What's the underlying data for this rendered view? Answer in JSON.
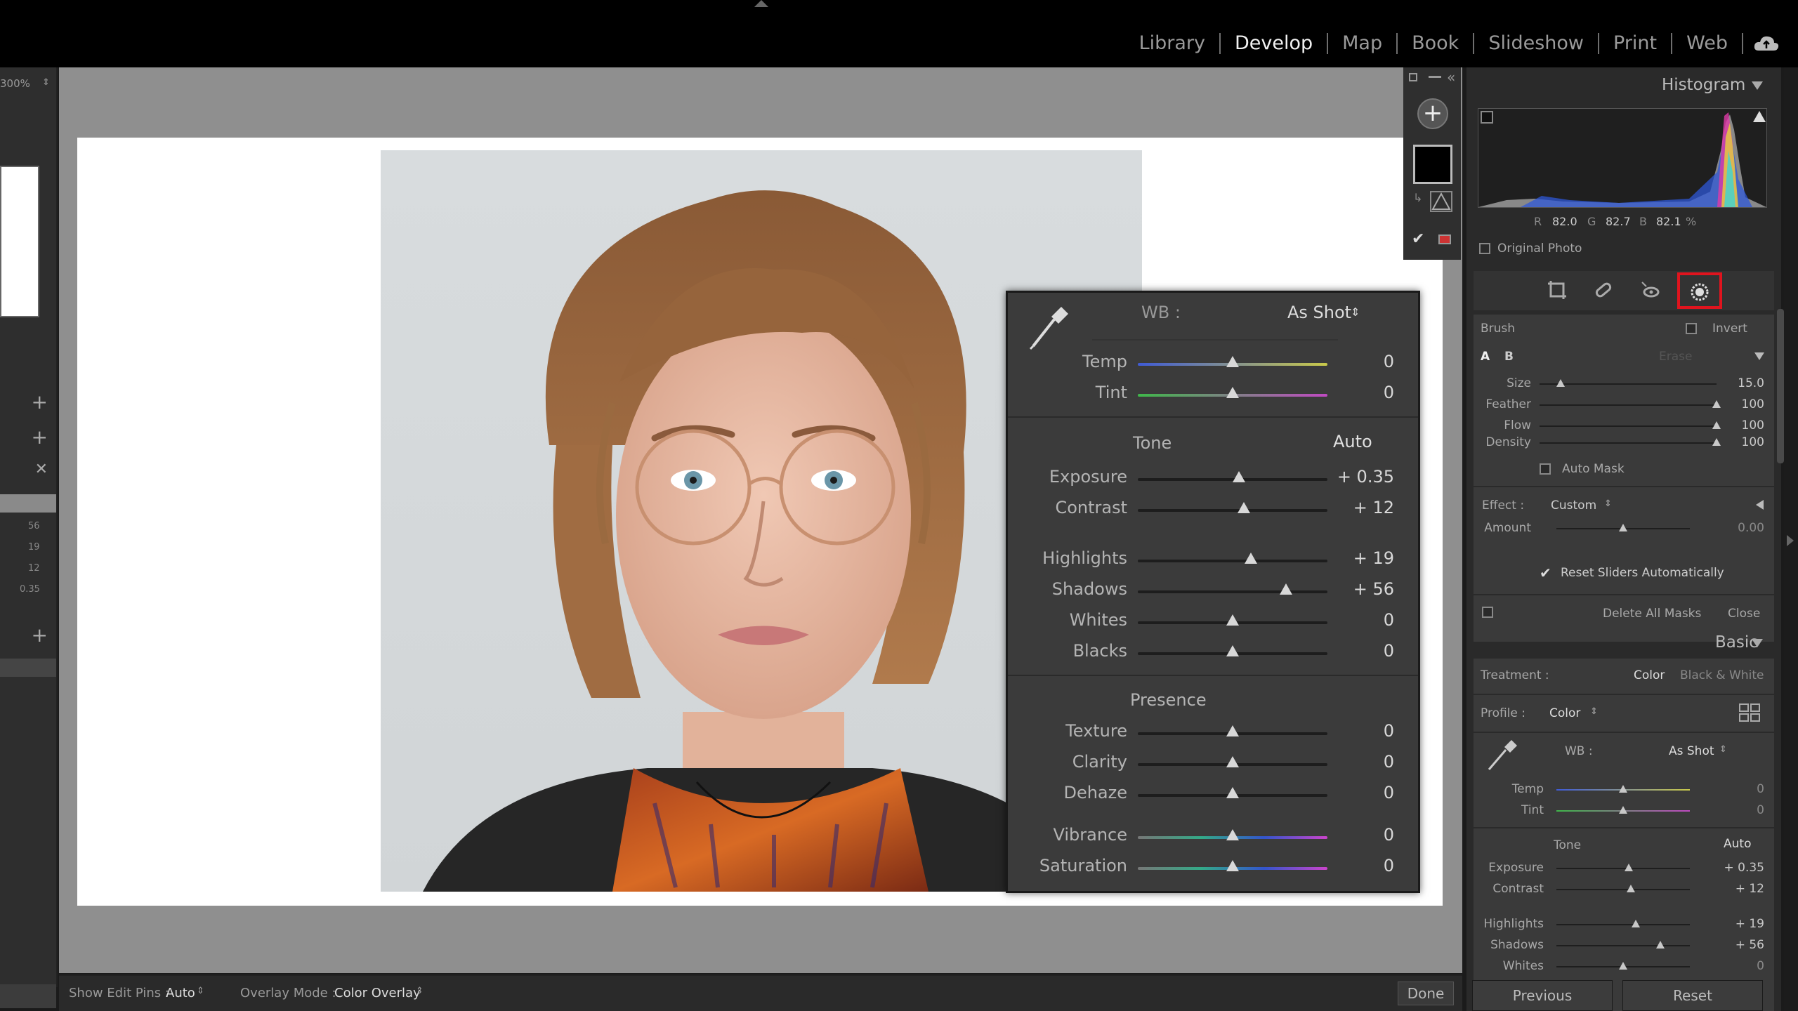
{
  "topbar": {
    "modules": [
      "Library",
      "Develop",
      "Map",
      "Book",
      "Slideshow",
      "Print",
      "Web"
    ],
    "active": "Develop"
  },
  "leftpanel": {
    "zoom": "300%",
    "values": [
      "56",
      "19",
      "12",
      "0.35"
    ]
  },
  "bottombar": {
    "show_edit_pins_label": "Show Edit Pins :",
    "show_edit_pins_value": "Auto",
    "overlay_mode_label": "Overlay Mode :",
    "overlay_mode_value": "Color Overlay",
    "done_label": "Done"
  },
  "floating": {
    "wb_label": "WB :",
    "wb_value": "As Shot",
    "temp": {
      "label": "Temp",
      "value": "0",
      "pos": 0.5
    },
    "tint": {
      "label": "Tint",
      "value": "0",
      "pos": 0.5
    },
    "tone_label": "Tone",
    "auto_label": "Auto",
    "exposure": {
      "label": "Exposure",
      "value": "+ 0.35",
      "pos": 0.535
    },
    "contrast": {
      "label": "Contrast",
      "value": "+ 12",
      "pos": 0.56
    },
    "highlights": {
      "label": "Highlights",
      "value": "+ 19",
      "pos": 0.595
    },
    "shadows": {
      "label": "Shadows",
      "value": "+ 56",
      "pos": 0.78
    },
    "whites": {
      "label": "Whites",
      "value": "0",
      "pos": 0.5
    },
    "blacks": {
      "label": "Blacks",
      "value": "0",
      "pos": 0.5
    },
    "presence_label": "Presence",
    "texture": {
      "label": "Texture",
      "value": "0",
      "pos": 0.5
    },
    "clarity": {
      "label": "Clarity",
      "value": "0",
      "pos": 0.5
    },
    "dehaze": {
      "label": "Dehaze",
      "value": "0",
      "pos": 0.5
    },
    "vibrance": {
      "label": "Vibrance",
      "value": "0",
      "pos": 0.5
    },
    "saturation": {
      "label": "Saturation",
      "value": "0",
      "pos": 0.5
    }
  },
  "histogram": {
    "title": "Histogram",
    "r_label": "R",
    "r_value": "82.0",
    "g_label": "G",
    "g_value": "82.7",
    "b_label": "B",
    "b_value": "82.1",
    "unit": "%",
    "original_photo": "Original Photo"
  },
  "brush": {
    "title": "Brush",
    "invert": "Invert",
    "a": "A",
    "b": "B",
    "erase": "Erase",
    "size": {
      "label": "Size",
      "value": "15.0",
      "pos": 0.12
    },
    "feather": {
      "label": "Feather",
      "value": "100",
      "pos": 1.0
    },
    "flow": {
      "label": "Flow",
      "value": "100",
      "pos": 1.0
    },
    "density": {
      "label": "Density",
      "value": "100",
      "pos": 1.0
    },
    "auto_mask": "Auto Mask",
    "effect_label": "Effect :",
    "effect_value": "Custom",
    "amount": {
      "label": "Amount",
      "value": "0.00",
      "pos": 0.5
    },
    "reset_sliders": "Reset Sliders Automatically",
    "delete_all_masks": "Delete All Masks",
    "close": "Close"
  },
  "basic": {
    "title": "Basic",
    "treatment_label": "Treatment :",
    "color": "Color",
    "bw": "Black & White",
    "profile_label": "Profile :",
    "profile_value": "Color",
    "wb_label": "WB :",
    "wb_value": "As Shot",
    "temp": {
      "label": "Temp",
      "value": "0",
      "pos": 0.5
    },
    "tint": {
      "label": "Tint",
      "value": "0",
      "pos": 0.5
    },
    "tone_label": "Tone",
    "auto_label": "Auto",
    "exposure": {
      "label": "Exposure",
      "value": "+ 0.35",
      "pos": 0.54
    },
    "contrast": {
      "label": "Contrast",
      "value": "+ 12",
      "pos": 0.56
    },
    "highlights": {
      "label": "Highlights",
      "value": "+ 19",
      "pos": 0.595
    },
    "shadows": {
      "label": "Shadows",
      "value": "+ 56",
      "pos": 0.78
    },
    "whites": {
      "label": "Whites",
      "value": "0",
      "pos": 0.5
    }
  },
  "footer": {
    "previous": "Previous",
    "reset": "Reset"
  },
  "colors": {
    "accent_red": "#e0141e",
    "temp_gradient": [
      "#3f5bd6",
      "#c9c94a"
    ],
    "tint_gradient": [
      "#3fb74a",
      "#c04ac2"
    ]
  }
}
